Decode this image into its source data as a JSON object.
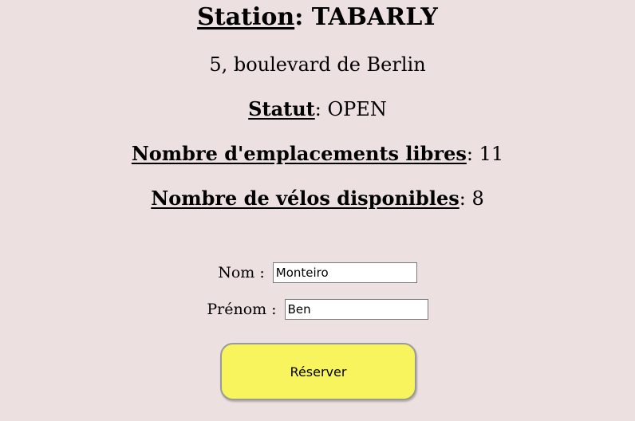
{
  "station": {
    "title_key": "Station",
    "title_sep": ":",
    "name": "TABARLY",
    "address": "5, boulevard de Berlin",
    "status_key": "Statut",
    "status_value": ": OPEN",
    "free_slots_key": "Nombre d'emplacements libres",
    "free_slots_value": ": 11",
    "bikes_key": "Nombre de vélos disponibles",
    "bikes_value": ": 8"
  },
  "form": {
    "nom_label": "Nom :",
    "nom_value": "Monteiro",
    "prenom_label": "Prénom :",
    "prenom_value": "Ben",
    "reserve_label": "Réserver"
  },
  "colors": {
    "background": "#ede0e1",
    "button": "#f7f45e"
  }
}
